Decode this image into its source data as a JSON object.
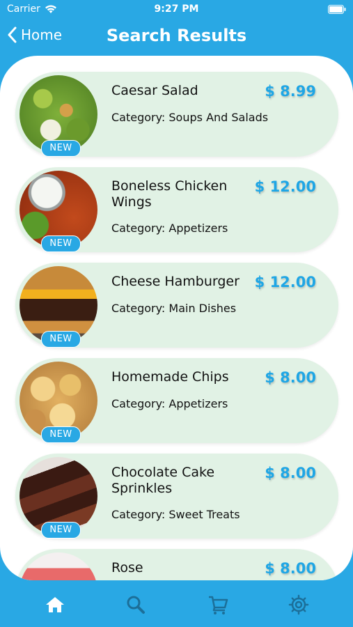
{
  "status_bar": {
    "carrier": "Carrier",
    "time": "9:27 PM"
  },
  "nav": {
    "back_label": "Home",
    "title": "Search Results"
  },
  "items": [
    {
      "name": "Caesar Salad",
      "price": "$ 8.99",
      "category": "Category: Soups And Salads",
      "badge": "NEW"
    },
    {
      "name": "Boneless Chicken Wings",
      "price": "$ 12.00",
      "category": "Category: Appetizers",
      "badge": "NEW"
    },
    {
      "name": "Cheese Hamburger",
      "price": "$ 12.00",
      "category": "Category: Main Dishes",
      "badge": "NEW"
    },
    {
      "name": "Homemade Chips",
      "price": "$ 8.00",
      "category": "Category: Appetizers",
      "badge": "NEW"
    },
    {
      "name": "Chocolate Cake Sprinkles",
      "price": "$ 8.00",
      "category": "Category: Sweet Treats",
      "badge": "NEW"
    },
    {
      "name": "Rose",
      "price": "$ 8.00",
      "category": "",
      "badge": ""
    }
  ],
  "tabs": [
    {
      "icon": "home-icon",
      "active": true
    },
    {
      "icon": "search-icon",
      "active": false
    },
    {
      "icon": "cart-icon",
      "active": false
    },
    {
      "icon": "settings-icon",
      "active": false
    }
  ],
  "colors": {
    "accent": "#29a8e4",
    "card": "#e1f2e5",
    "price": "#1fa6e5",
    "tab_inactive": "#1c6f99"
  }
}
